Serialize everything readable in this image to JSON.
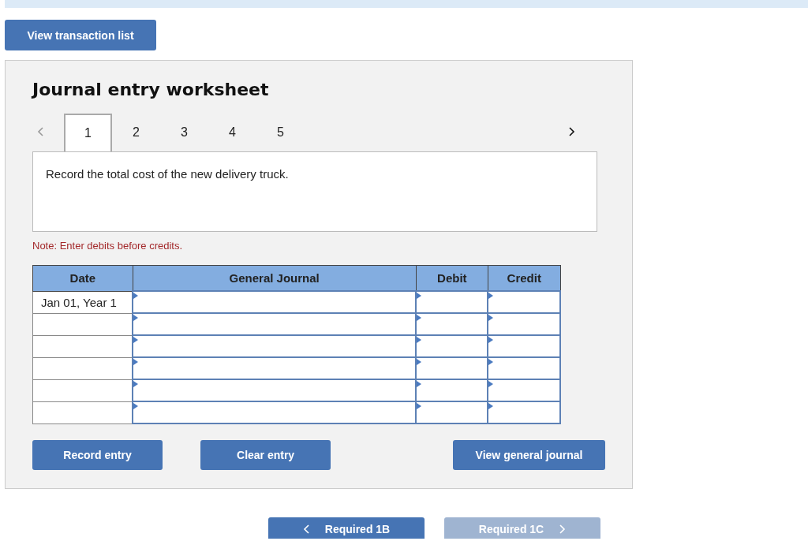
{
  "top_button": "View transaction list",
  "worksheet": {
    "title": "Journal entry worksheet",
    "pager": {
      "prev_disabled": true,
      "next_disabled": false
    },
    "tabs": [
      {
        "label": "1",
        "selected": true
      },
      {
        "label": "2",
        "selected": false
      },
      {
        "label": "3",
        "selected": false
      },
      {
        "label": "4",
        "selected": false
      },
      {
        "label": "5",
        "selected": false
      }
    ],
    "instruction": "Record the total cost of the new delivery truck.",
    "note": "Note: Enter debits before credits.",
    "table": {
      "columns": [
        "Date",
        "General Journal",
        "Debit",
        "Credit"
      ],
      "rows": [
        {
          "date": "Jan 01, Year 1"
        },
        {},
        {},
        {},
        {},
        {}
      ]
    },
    "buttons": [
      "Record entry",
      "Clear entry",
      "View general journal"
    ]
  },
  "nav": [
    {
      "label": "Required 1B",
      "kind": "prev",
      "disabled": false
    },
    {
      "label": "Required 1C",
      "kind": "next",
      "disabled": true
    }
  ]
}
